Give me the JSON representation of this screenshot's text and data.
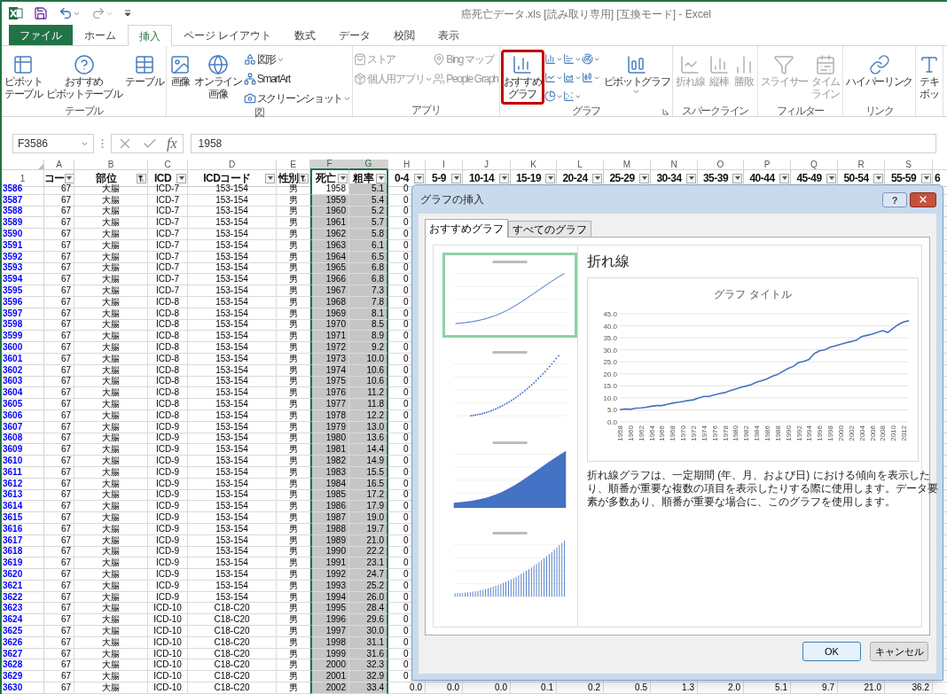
{
  "window": {
    "title": "癌死亡データ.xls [読み取り専用] [互換モード] - Excel"
  },
  "tabs": [
    {
      "label": "ファイル",
      "kind": "file",
      "selected": false
    },
    {
      "label": "ホーム",
      "kind": "tab",
      "selected": false
    },
    {
      "label": "挿入",
      "kind": "tab",
      "selected": true
    },
    {
      "label": "ページ レイアウト",
      "kind": "tab",
      "selected": false
    },
    {
      "label": "数式",
      "kind": "tab",
      "selected": false
    },
    {
      "label": "データ",
      "kind": "tab",
      "selected": false
    },
    {
      "label": "校閲",
      "kind": "tab",
      "selected": false
    },
    {
      "label": "表示",
      "kind": "tab",
      "selected": false
    }
  ],
  "ribbon": {
    "groups": [
      {
        "label": "テーブル",
        "items": [
          {
            "kind": "large",
            "lines": [
              "ピボット",
              "テーブル"
            ],
            "disabled": false
          },
          {
            "kind": "large",
            "lines": [
              "おすすめ",
              "ピボットテーブル"
            ],
            "disabled": false
          },
          {
            "kind": "large",
            "lines": [
              "テーブル"
            ],
            "disabled": false
          }
        ]
      },
      {
        "label": "図",
        "items": [
          {
            "kind": "large",
            "lines": [
              "画像"
            ],
            "disabled": false
          },
          {
            "kind": "large",
            "lines": [
              "オンライン",
              "画像"
            ],
            "disabled": false
          },
          {
            "kind": "stack",
            "items": [
              {
                "label": "図形",
                "dropdown": true,
                "disabled": false
              },
              {
                "label": "SmartArt",
                "dropdown": false,
                "disabled": false
              },
              {
                "label": "スクリーンショット",
                "dropdown": true,
                "disabled": false
              }
            ]
          }
        ]
      },
      {
        "label": "アプリ",
        "items": [
          {
            "kind": "stack",
            "items": [
              {
                "label": "ストア",
                "dropdown": false,
                "disabled": true
              },
              {
                "label": "個人用アプリ",
                "dropdown": true,
                "disabled": true
              }
            ]
          },
          {
            "kind": "stack",
            "items": [
              {
                "label": "Bing マップ",
                "dropdown": false,
                "disabled": true
              },
              {
                "label": "People Graph",
                "dropdown": false,
                "disabled": true
              }
            ]
          }
        ]
      },
      {
        "label": "グラフ",
        "launcher": true,
        "items": [
          {
            "kind": "large",
            "lines": [
              "おすすめ",
              "グラフ"
            ],
            "disabled": false,
            "highlighted": true
          },
          {
            "kind": "gallery"
          },
          {
            "kind": "large",
            "lines": [
              "ピボットグラフ"
            ],
            "disabled": false,
            "dropdown": true
          }
        ]
      },
      {
        "label": "スパークライン",
        "items": [
          {
            "kind": "large",
            "lines": [
              "折れ線"
            ],
            "disabled": true
          },
          {
            "kind": "large",
            "lines": [
              "縦棒"
            ],
            "disabled": true
          },
          {
            "kind": "large",
            "lines": [
              "勝敗"
            ],
            "disabled": true
          }
        ]
      },
      {
        "label": "フィルター",
        "items": [
          {
            "kind": "large",
            "lines": [
              "スライサー"
            ],
            "disabled": true
          },
          {
            "kind": "large",
            "lines": [
              "タイム",
              "ライン"
            ],
            "disabled": true
          }
        ]
      },
      {
        "label": "リンク",
        "items": [
          {
            "kind": "large",
            "lines": [
              "ハイパーリンク"
            ],
            "disabled": false
          }
        ]
      },
      {
        "items": [
          {
            "kind": "large",
            "lines": [
              "テキ",
              "ボッ"
            ],
            "disabled": false
          }
        ]
      }
    ]
  },
  "formula_bar": {
    "name_box": "F3586",
    "function_label": "fx",
    "value": "1958"
  },
  "sheet": {
    "columns": [
      {
        "kind": "row-header",
        "header": "1",
        "selected": false
      },
      {
        "kind": "data",
        "letter": "A",
        "header": "コー",
        "filter_applied": false,
        "selected": false
      },
      {
        "kind": "data",
        "letter": "B",
        "header": "部位",
        "filter_applied": true,
        "selected": false
      },
      {
        "kind": "data",
        "letter": "C",
        "header": "ICD",
        "filter_applied": false,
        "selected": false
      },
      {
        "kind": "data",
        "letter": "D",
        "header": "ICDコード",
        "filter_applied": false,
        "selected": false
      },
      {
        "kind": "data",
        "letter": "E",
        "header": "性別",
        "filter_applied": true,
        "selected": false
      },
      {
        "kind": "data",
        "letter": "F",
        "header": "死亡",
        "filter_applied": false,
        "selected": true
      },
      {
        "kind": "data",
        "letter": "G",
        "header": "粗率",
        "filter_applied": false,
        "selected": true
      },
      {
        "kind": "data",
        "letter": "H",
        "header": "0-4",
        "filter_applied": false,
        "selected": false
      },
      {
        "kind": "data",
        "letter": "I",
        "header": "5-9",
        "filter_applied": false,
        "selected": false
      },
      {
        "kind": "data",
        "letter": "J",
        "header": "10-14",
        "filter_applied": false,
        "selected": false
      },
      {
        "kind": "data",
        "letter": "K",
        "header": "15-19",
        "filter_applied": false,
        "selected": false
      },
      {
        "kind": "data",
        "letter": "L",
        "header": "20-24",
        "filter_applied": false,
        "selected": false
      },
      {
        "kind": "data",
        "letter": "M",
        "header": "25-29",
        "filter_applied": false,
        "selected": false
      },
      {
        "kind": "data",
        "letter": "N",
        "header": "30-34",
        "filter_applied": false,
        "selected": false
      },
      {
        "kind": "data",
        "letter": "O",
        "header": "35-39",
        "filter_applied": false,
        "selected": false
      },
      {
        "kind": "data",
        "letter": "P",
        "header": "40-44",
        "filter_applied": false,
        "selected": false
      },
      {
        "kind": "data",
        "letter": "Q",
        "header": "45-49",
        "filter_applied": false,
        "selected": false
      },
      {
        "kind": "data",
        "letter": "R",
        "header": "50-54",
        "filter_applied": false,
        "selected": false
      },
      {
        "kind": "data",
        "letter": "S",
        "header": "55-59",
        "filter_applied": false,
        "selected": false
      }
    ],
    "partial_header": "6",
    "rows": [
      {
        "active": true,
        "cells": [
          "3586",
          "67",
          "大腸",
          "ICD-7",
          "153-154",
          "男",
          "1958",
          "5.1",
          "0"
        ]
      },
      {
        "active": false,
        "cells": [
          "3587",
          "67",
          "大腸",
          "ICD-7",
          "153-154",
          "男",
          "1959",
          "5.4",
          "0"
        ]
      },
      {
        "active": false,
        "cells": [
          "3588",
          "67",
          "大腸",
          "ICD-7",
          "153-154",
          "男",
          "1960",
          "5.2",
          "0"
        ]
      },
      {
        "active": false,
        "cells": [
          "3589",
          "67",
          "大腸",
          "ICD-7",
          "153-154",
          "男",
          "1961",
          "5.7",
          "0"
        ]
      },
      {
        "active": false,
        "cells": [
          "3590",
          "67",
          "大腸",
          "ICD-7",
          "153-154",
          "男",
          "1962",
          "5.8",
          "0"
        ]
      },
      {
        "active": false,
        "cells": [
          "3591",
          "67",
          "大腸",
          "ICD-7",
          "153-154",
          "男",
          "1963",
          "6.1",
          "0"
        ]
      },
      {
        "active": false,
        "cells": [
          "3592",
          "67",
          "大腸",
          "ICD-7",
          "153-154",
          "男",
          "1964",
          "6.5",
          "0"
        ]
      },
      {
        "active": false,
        "cells": [
          "3593",
          "67",
          "大腸",
          "ICD-7",
          "153-154",
          "男",
          "1965",
          "6.8",
          "0"
        ]
      },
      {
        "active": false,
        "cells": [
          "3594",
          "67",
          "大腸",
          "ICD-7",
          "153-154",
          "男",
          "1966",
          "6.8",
          "0"
        ]
      },
      {
        "active": false,
        "cells": [
          "3595",
          "67",
          "大腸",
          "ICD-7",
          "153-154",
          "男",
          "1967",
          "7.3",
          "0"
        ]
      },
      {
        "active": false,
        "cells": [
          "3596",
          "67",
          "大腸",
          "ICD-8",
          "153-154",
          "男",
          "1968",
          "7.8",
          "0"
        ]
      },
      {
        "active": false,
        "cells": [
          "3597",
          "67",
          "大腸",
          "ICD-8",
          "153-154",
          "男",
          "1969",
          "8.1",
          "0"
        ]
      },
      {
        "active": false,
        "cells": [
          "3598",
          "67",
          "大腸",
          "ICD-8",
          "153-154",
          "男",
          "1970",
          "8.5",
          "0"
        ]
      },
      {
        "active": false,
        "cells": [
          "3599",
          "67",
          "大腸",
          "ICD-8",
          "153-154",
          "男",
          "1971",
          "8.9",
          "0"
        ]
      },
      {
        "active": false,
        "cells": [
          "3600",
          "67",
          "大腸",
          "ICD-8",
          "153-154",
          "男",
          "1972",
          "9.2",
          "0"
        ]
      },
      {
        "active": false,
        "cells": [
          "3601",
          "67",
          "大腸",
          "ICD-8",
          "153-154",
          "男",
          "1973",
          "10.0",
          "0"
        ]
      },
      {
        "active": false,
        "cells": [
          "3602",
          "67",
          "大腸",
          "ICD-8",
          "153-154",
          "男",
          "1974",
          "10.6",
          "0"
        ]
      },
      {
        "active": false,
        "cells": [
          "3603",
          "67",
          "大腸",
          "ICD-8",
          "153-154",
          "男",
          "1975",
          "10.6",
          "0"
        ]
      },
      {
        "active": false,
        "cells": [
          "3604",
          "67",
          "大腸",
          "ICD-8",
          "153-154",
          "男",
          "1976",
          "11.2",
          "0"
        ]
      },
      {
        "active": false,
        "cells": [
          "3605",
          "67",
          "大腸",
          "ICD-8",
          "153-154",
          "男",
          "1977",
          "11.8",
          "0"
        ]
      },
      {
        "active": false,
        "cells": [
          "3606",
          "67",
          "大腸",
          "ICD-8",
          "153-154",
          "男",
          "1978",
          "12.2",
          "0"
        ]
      },
      {
        "active": false,
        "cells": [
          "3607",
          "67",
          "大腸",
          "ICD-9",
          "153-154",
          "男",
          "1979",
          "13.0",
          "0"
        ]
      },
      {
        "active": false,
        "cells": [
          "3608",
          "67",
          "大腸",
          "ICD-9",
          "153-154",
          "男",
          "1980",
          "13.6",
          "0"
        ]
      },
      {
        "active": false,
        "cells": [
          "3609",
          "67",
          "大腸",
          "ICD-9",
          "153-154",
          "男",
          "1981",
          "14.4",
          "0"
        ]
      },
      {
        "active": false,
        "cells": [
          "3610",
          "67",
          "大腸",
          "ICD-9",
          "153-154",
          "男",
          "1982",
          "14.9",
          "0"
        ]
      },
      {
        "active": false,
        "cells": [
          "3611",
          "67",
          "大腸",
          "ICD-9",
          "153-154",
          "男",
          "1983",
          "15.5",
          "0"
        ]
      },
      {
        "active": false,
        "cells": [
          "3612",
          "67",
          "大腸",
          "ICD-9",
          "153-154",
          "男",
          "1984",
          "16.5",
          "0"
        ]
      },
      {
        "active": false,
        "cells": [
          "3613",
          "67",
          "大腸",
          "ICD-9",
          "153-154",
          "男",
          "1985",
          "17.2",
          "0"
        ]
      },
      {
        "active": false,
        "cells": [
          "3614",
          "67",
          "大腸",
          "ICD-9",
          "153-154",
          "男",
          "1986",
          "17.9",
          "0"
        ]
      },
      {
        "active": false,
        "cells": [
          "3615",
          "67",
          "大腸",
          "ICD-9",
          "153-154",
          "男",
          "1987",
          "19.0",
          "0"
        ]
      },
      {
        "active": false,
        "cells": [
          "3616",
          "67",
          "大腸",
          "ICD-9",
          "153-154",
          "男",
          "1988",
          "19.7",
          "0"
        ]
      },
      {
        "active": false,
        "cells": [
          "3617",
          "67",
          "大腸",
          "ICD-9",
          "153-154",
          "男",
          "1989",
          "21.0",
          "0"
        ]
      },
      {
        "active": false,
        "cells": [
          "3618",
          "67",
          "大腸",
          "ICD-9",
          "153-154",
          "男",
          "1990",
          "22.2",
          "0"
        ]
      },
      {
        "active": false,
        "cells": [
          "3619",
          "67",
          "大腸",
          "ICD-9",
          "153-154",
          "男",
          "1991",
          "23.1",
          "0"
        ]
      },
      {
        "active": false,
        "cells": [
          "3620",
          "67",
          "大腸",
          "ICD-9",
          "153-154",
          "男",
          "1992",
          "24.7",
          "0"
        ]
      },
      {
        "active": false,
        "cells": [
          "3621",
          "67",
          "大腸",
          "ICD-9",
          "153-154",
          "男",
          "1993",
          "25.2",
          "0"
        ]
      },
      {
        "active": false,
        "cells": [
          "3622",
          "67",
          "大腸",
          "ICD-9",
          "153-154",
          "男",
          "1994",
          "26.0",
          "0"
        ]
      },
      {
        "active": false,
        "cells": [
          "3623",
          "67",
          "大腸",
          "ICD-10",
          "C18-C20",
          "男",
          "1995",
          "28.4",
          "0"
        ]
      },
      {
        "active": false,
        "cells": [
          "3624",
          "67",
          "大腸",
          "ICD-10",
          "C18-C20",
          "男",
          "1996",
          "29.6",
          "0"
        ]
      },
      {
        "active": false,
        "cells": [
          "3625",
          "67",
          "大腸",
          "ICD-10",
          "C18-C20",
          "男",
          "1997",
          "30.0",
          "0"
        ]
      },
      {
        "active": false,
        "cells": [
          "3626",
          "67",
          "大腸",
          "ICD-10",
          "C18-C20",
          "男",
          "1998",
          "31.1",
          "0"
        ]
      },
      {
        "active": false,
        "cells": [
          "3627",
          "67",
          "大腸",
          "ICD-10",
          "C18-C20",
          "男",
          "1999",
          "31.6",
          "0"
        ]
      },
      {
        "active": false,
        "cells": [
          "3628",
          "67",
          "大腸",
          "ICD-10",
          "C18-C20",
          "男",
          "2000",
          "32.3",
          "0"
        ]
      },
      {
        "active": false,
        "cells": [
          "3629",
          "67",
          "大腸",
          "ICD-10",
          "C18-C20",
          "男",
          "2001",
          "32.9",
          "0"
        ]
      },
      {
        "active": false,
        "cells": [
          "3630",
          "67",
          "大腸",
          "ICD-10",
          "C18-C20",
          "男",
          "2002",
          "33.4",
          "0.0",
          "0.0",
          "0.0",
          "0.1",
          "0.2",
          "0.5",
          "1.3",
          "2.0",
          "5.1",
          "9.7",
          "21.0",
          "36.2"
        ]
      }
    ]
  },
  "dialog": {
    "title": "グラフの挿入",
    "help": "?",
    "tabs": [
      {
        "label": "おすすめグラフ",
        "selected": true
      },
      {
        "label": "すべてのグラフ",
        "selected": false
      }
    ],
    "thumbnails": [
      {
        "kind": "line",
        "selected": true
      },
      {
        "kind": "scatter",
        "selected": false
      },
      {
        "kind": "area",
        "selected": false
      },
      {
        "kind": "column",
        "selected": false
      }
    ],
    "heading": "折れ線",
    "preview": {
      "chart_data": {
        "type": "line",
        "title": "グラフ タイトル",
        "grid": true,
        "xlim": [
          1958,
          2013
        ],
        "x": [
          1958,
          1959,
          1960,
          1961,
          1962,
          1963,
          1964,
          1965,
          1966,
          1967,
          1968,
          1969,
          1970,
          1971,
          1972,
          1973,
          1974,
          1975,
          1976,
          1977,
          1978,
          1979,
          1980,
          1981,
          1982,
          1983,
          1984,
          1985,
          1986,
          1987,
          1988,
          1989,
          1990,
          1991,
          1992,
          1993,
          1994,
          1995,
          1996,
          1997,
          1998,
          1999,
          2000,
          2001,
          2002,
          2003,
          2004,
          2005,
          2006,
          2007,
          2008,
          2009,
          2010,
          2011,
          2012,
          2013
        ],
        "series": [
          {
            "color": "#4472c4",
            "values": [
              5.1,
              5.4,
              5.2,
              5.7,
              5.8,
              6.1,
              6.5,
              6.8,
              6.8,
              7.3,
              7.8,
              8.1,
              8.5,
              8.9,
              9.2,
              10.0,
              10.6,
              10.6,
              11.2,
              11.8,
              12.2,
              13.0,
              13.6,
              14.4,
              14.9,
              15.5,
              16.5,
              17.2,
              17.9,
              19.0,
              19.7,
              21.0,
              22.2,
              23.1,
              24.7,
              25.2,
              26.0,
              28.4,
              29.6,
              30.0,
              31.1,
              31.6,
              32.3,
              32.9,
              33.4,
              34.0,
              35.5,
              36.0,
              36.5,
              37.3,
              38.0,
              37.2,
              39.0,
              40.5,
              41.6,
              42.1
            ]
          }
        ],
        "ylim": [
          0,
          45
        ],
        "yticks": [
          {
            "value": 0,
            "label": "0.0"
          },
          {
            "value": 5,
            "label": "5.0"
          },
          {
            "value": 10,
            "label": "10.0"
          },
          {
            "value": 15,
            "label": "15.0"
          },
          {
            "value": 20,
            "label": "20.0"
          },
          {
            "value": 25,
            "label": "25.0"
          },
          {
            "value": 30,
            "label": "30.0"
          },
          {
            "value": 35,
            "label": "35.0"
          },
          {
            "value": 40,
            "label": "40.0"
          },
          {
            "value": 45,
            "label": "45.0"
          }
        ],
        "xticks": [
          1958,
          1960,
          1962,
          1964,
          1966,
          1968,
          1970,
          1972,
          1974,
          1976,
          1978,
          1980,
          1982,
          1984,
          1986,
          1988,
          1990,
          1992,
          1994,
          1996,
          1998,
          2000,
          2002,
          2004,
          2006,
          2008,
          2010,
          2012
        ]
      }
    },
    "description": "折れ線グラフは、一定期間 (年、月、および日) における傾向を表示したり、順番が重要な複数の項目を表示したりする際に使用します。データ要素が多数あり、順番が重要な場合に、このグラフを使用します。",
    "buttons": [
      {
        "label": "OK",
        "kind": "primary"
      },
      {
        "label": "キャンセル",
        "kind": "normal"
      }
    ]
  }
}
